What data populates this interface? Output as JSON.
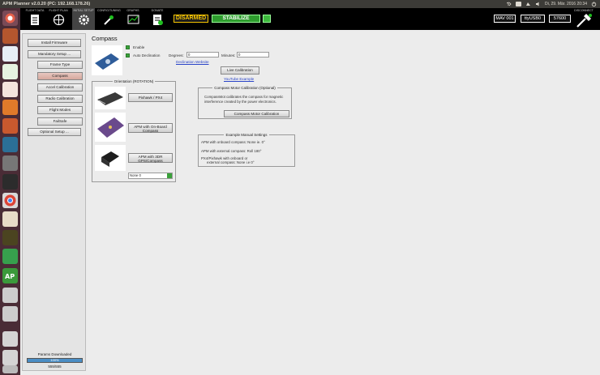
{
  "window": {
    "title": "APM Planner v2.0.20 (PC: 192.168.178.26)"
  },
  "system_tray": {
    "datetime": "Di, 29. Mär. 2016 20:34"
  },
  "toolbar": {
    "items": [
      {
        "label": "FLIGHT DATA",
        "icon": "instrument-icon"
      },
      {
        "label": "FLIGHT PLAN",
        "icon": "globe-icon"
      },
      {
        "label": "INITIAL SETUP",
        "icon": "gear-icon"
      },
      {
        "label": "CONFIG/TUNING",
        "icon": "wrench-icon"
      },
      {
        "label": "GRAPHS",
        "icon": "graph-icon"
      },
      {
        "label": "DONATE",
        "icon": "donate-icon"
      }
    ],
    "arm_status": "DISARMED",
    "flight_mode": "STABILIZE",
    "mav": "MAV 001",
    "port": "ttyUSB0",
    "baud": "57600",
    "disconnect_label": "DISCONNECT"
  },
  "sidebar": {
    "install_firmware": "Install Firmware",
    "mandatory_setup": "Mandatory Setup ...",
    "items": [
      "Frame Type",
      "Compass",
      "Accel Calibration",
      "Radio Calibration",
      "Flight Modes",
      "FailSafe"
    ],
    "optional_setup": "Optional Setup ...",
    "params_label": "Params Downloaded",
    "params_progress": "100%",
    "params_count": "555/555"
  },
  "compass": {
    "title": "Compass",
    "enable_label": "Enable",
    "auto_declination_label": "Auto Declination",
    "degrees_label": "Degrees:",
    "degrees_value": "0",
    "minutes_label": "Minutes:",
    "minutes_value": "0",
    "declination_link": "Declination Website",
    "live_calibration": "Live Calibration",
    "youtube_link": "YouTube Example",
    "orientation_title": "Orientation (ROTATION)",
    "board_pixhawk": "Pixhawk / PX4",
    "board_apm_onboard": "APM with On-Board Compass",
    "board_apm_3dr": "APM with 3DR GPS/Compass",
    "rotation_select": "None 0",
    "motor_cal_title": "Compass Motor Calibration (Optional)",
    "motor_cal_text": "CompassMot calibrates the compass for magnetic interference created by the power electronics.",
    "motor_cal_button": "Compass Motor Calibration",
    "example_title": "Example Manual Settings",
    "example_lines": [
      "APM with onboard compass: None ie. 0°",
      "APM with external compass: Roll 180°",
      "PX4/Pixhawk with onboard or",
      "external compass: None i.e 0°"
    ]
  }
}
